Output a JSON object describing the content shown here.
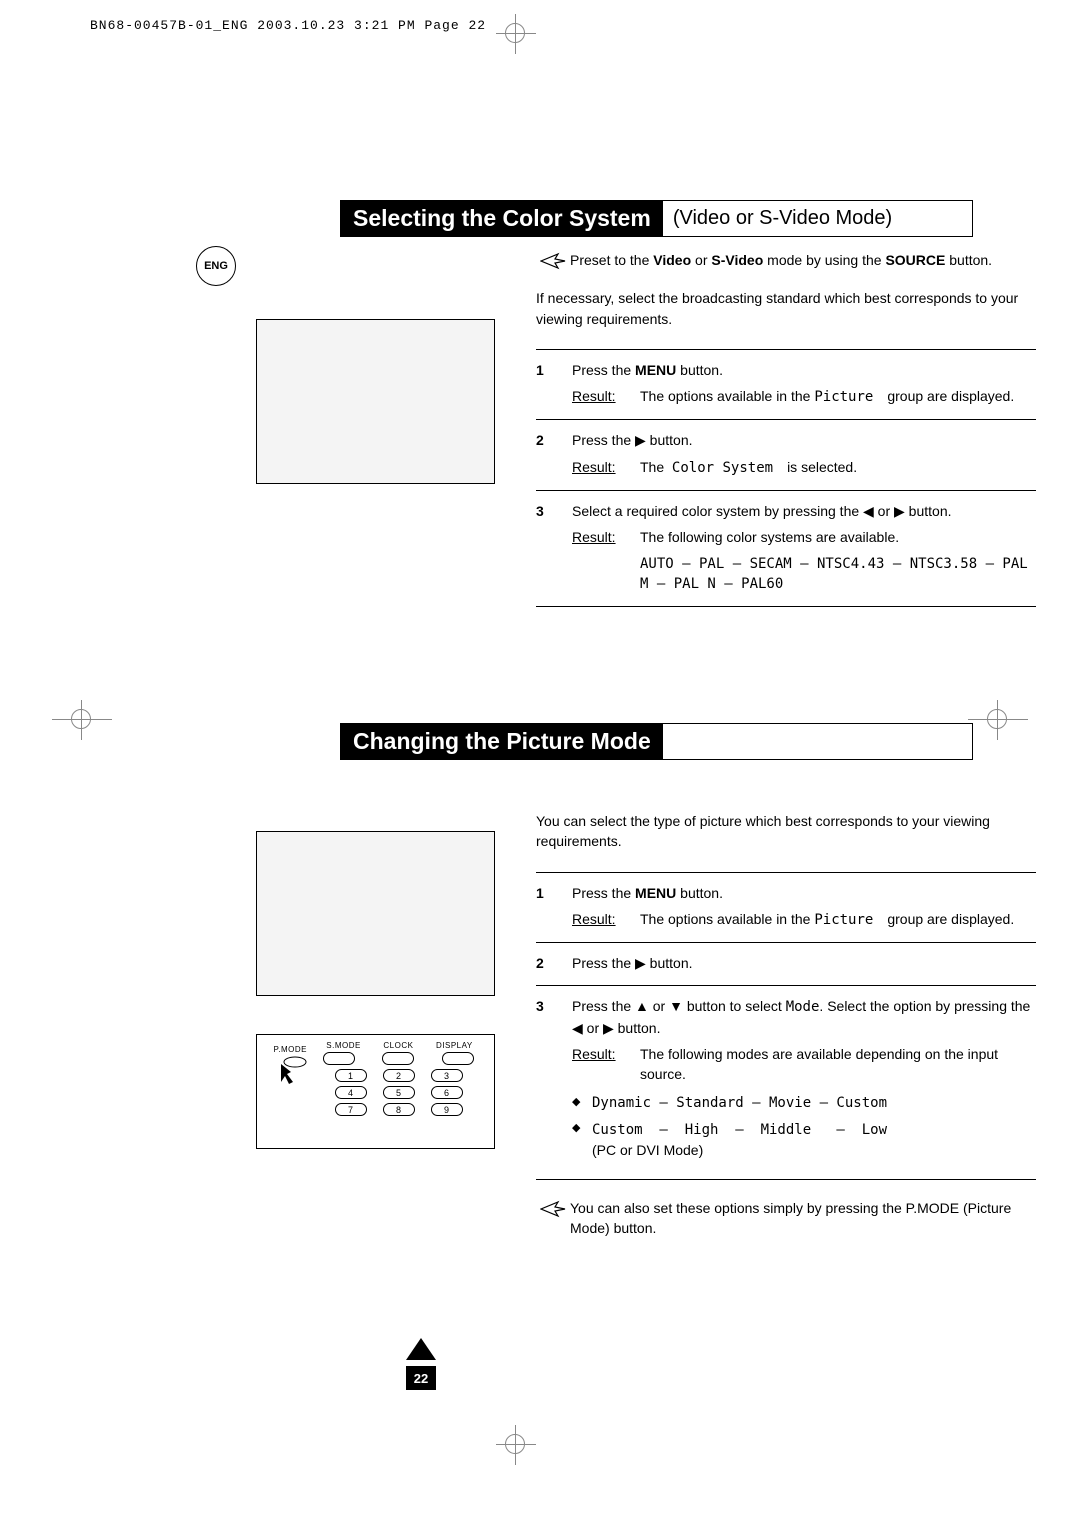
{
  "header_line": "BN68-00457B-01_ENG  2003.10.23  3:21 PM  Page 22",
  "lang_badge": "ENG",
  "page_number": "22",
  "section1": {
    "title_main": "Selecting the Color System",
    "title_sub": "(Video or S-Video Mode)",
    "preset_note": "Preset to the Video or S-Video mode by using the SOURCE button.",
    "intro": "If necessary, select the broadcasting standard which best corresponds to your viewing requirements.",
    "steps": [
      {
        "num": "1",
        "text": "Press the MENU button.",
        "result": "The options available in the Picture    group are displayed."
      },
      {
        "num": "2",
        "text": "Press the ▶ button.",
        "result": "The  Color System    is selected."
      },
      {
        "num": "3",
        "text": "Select a required color system by pressing the ◀ or ▶ button.",
        "result": "The following color systems are available.",
        "options": "AUTO –  PAL  –  SECAM –  NTSC4.43  –  NTSC3.58  – PAL M  –  PAL N  –  PAL60"
      }
    ]
  },
  "section2": {
    "title_main": "Changing the Picture Mode",
    "intro": "You can select the type of picture which best corresponds to your viewing requirements.",
    "steps": [
      {
        "num": "1",
        "text": "Press the MENU button.",
        "result": "The options available in the Picture    group are displayed."
      },
      {
        "num": "2",
        "text": "Press the ▶ button."
      },
      {
        "num": "3",
        "text": "Press the ▲ or ▼ button to select Mode. Select the option by pressing the ◀ or ▶ button.",
        "result": "The following modes are available depending on the input source.",
        "modes": [
          "Dynamic  –  Standard   –  Movie  –  Custom",
          "Custom  –  High  –  Middle   –  Low\n(PC or DVI Mode)"
        ]
      }
    ],
    "footnote": "You can also set these options simply by pressing the P.MODE (Picture Mode) button."
  },
  "remote": {
    "left_label": "P.MODE",
    "top_labels": [
      "S.MODE",
      "CLOCK",
      "DISPLAY"
    ],
    "keys": [
      "1",
      "2",
      "3",
      "4",
      "5",
      "6",
      "7",
      "8",
      "9"
    ]
  },
  "result_label": "Result:"
}
